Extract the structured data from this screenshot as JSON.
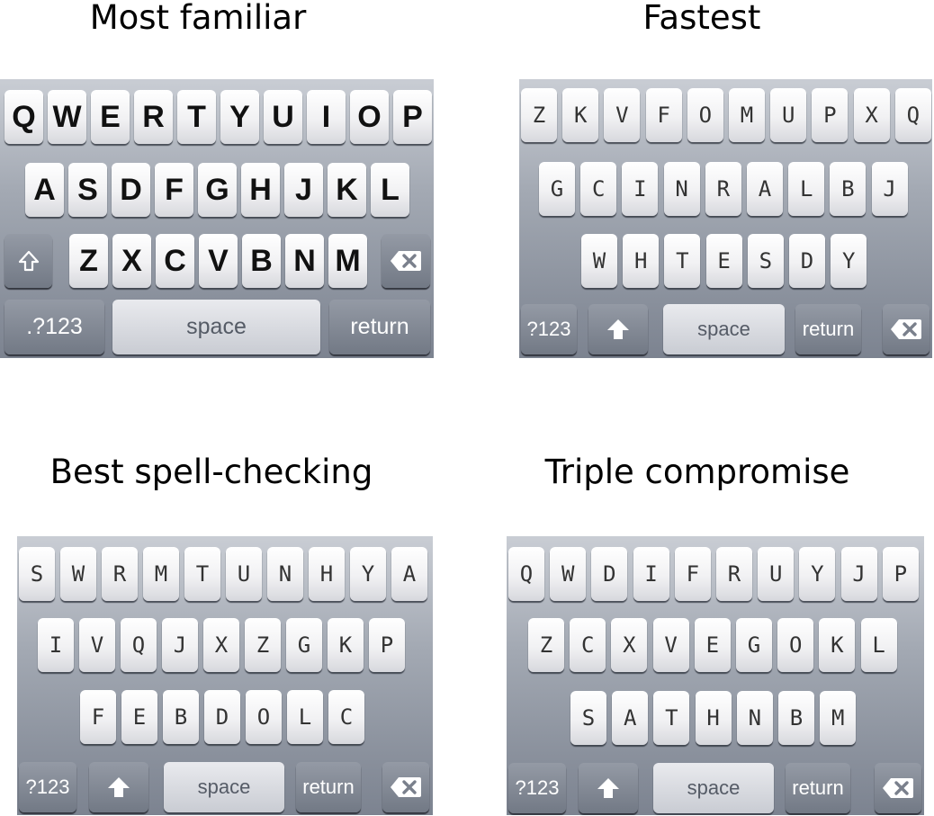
{
  "captions": {
    "top_left": "Most familiar",
    "top_right": "Fastest",
    "bottom_left": "Best spell-checking",
    "bottom_right": "Triple compromise"
  },
  "keyboards": {
    "familiar": {
      "row1": [
        "Q",
        "W",
        "E",
        "R",
        "T",
        "Y",
        "U",
        "I",
        "O",
        "P"
      ],
      "row2": [
        "A",
        "S",
        "D",
        "F",
        "G",
        "H",
        "J",
        "K",
        "L"
      ],
      "row3": [
        "Z",
        "X",
        "C",
        "V",
        "B",
        "N",
        "M"
      ],
      "numbers_label": ".?123",
      "space_label": "space",
      "return_label": "return"
    },
    "fastest": {
      "row1": [
        "Z",
        "K",
        "V",
        "F",
        "O",
        "M",
        "U",
        "P",
        "X",
        "Q"
      ],
      "row2": [
        "G",
        "C",
        "I",
        "N",
        "R",
        "A",
        "L",
        "B",
        "J"
      ],
      "row3": [
        "W",
        "H",
        "T",
        "E",
        "S",
        "D",
        "Y"
      ],
      "numbers_label": "?123",
      "space_label": "space",
      "return_label": "return"
    },
    "spell": {
      "row1": [
        "S",
        "W",
        "R",
        "M",
        "T",
        "U",
        "N",
        "H",
        "Y",
        "A"
      ],
      "row2": [
        "I",
        "V",
        "Q",
        "J",
        "X",
        "Z",
        "G",
        "K",
        "P"
      ],
      "row3": [
        "F",
        "E",
        "B",
        "D",
        "O",
        "L",
        "C"
      ],
      "numbers_label": "?123",
      "space_label": "space",
      "return_label": "return"
    },
    "triple": {
      "row1": [
        "Q",
        "W",
        "D",
        "I",
        "F",
        "R",
        "U",
        "Y",
        "J",
        "P"
      ],
      "row2": [
        "Z",
        "C",
        "X",
        "V",
        "E",
        "G",
        "O",
        "K",
        "L"
      ],
      "row3": [
        "S",
        "A",
        "T",
        "H",
        "N",
        "B",
        "M"
      ],
      "numbers_label": "?123",
      "space_label": "space",
      "return_label": "return"
    }
  },
  "icons": {
    "shift": "shift-arrow-icon",
    "delete": "backspace-icon"
  }
}
